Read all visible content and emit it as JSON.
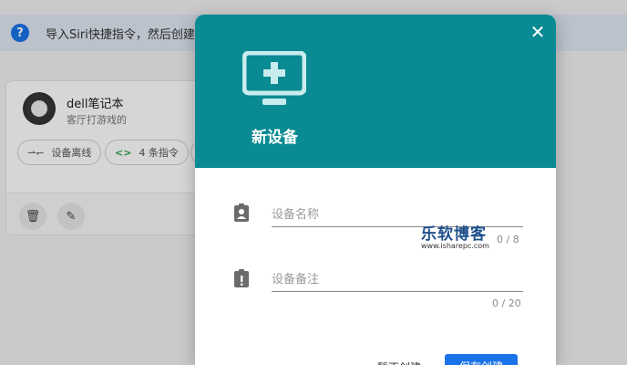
{
  "banner": {
    "icon": "question-circle-icon",
    "icon_glyph": "?",
    "text": "导入Siri快捷指令，然后创建"
  },
  "device_card": {
    "name": "dell笔记本",
    "note": "客厅打游戏的",
    "chips": [
      {
        "icon": "offline-arrows-icon",
        "glyph": "⇀↽",
        "label": "设备离线"
      },
      {
        "icon": "code-brackets-icon",
        "glyph": "<>",
        "label": "4 条指令"
      }
    ],
    "actions": [
      {
        "icon": "trash-icon",
        "glyph": "🗑"
      },
      {
        "icon": "pencil-icon",
        "glyph": "✎"
      }
    ]
  },
  "modal": {
    "header_color": "#0a8a92",
    "header_icon": "monitor-add-icon",
    "title": "新设备",
    "close_glyph": "✕",
    "fields": {
      "name": {
        "icon": "clipboard-account-icon",
        "placeholder": "设备名称",
        "value": "",
        "counter": "0 / 8"
      },
      "remark": {
        "icon": "clipboard-alert-icon",
        "placeholder": "设备备注",
        "value": "",
        "counter": "0 / 20"
      }
    },
    "cancel_label": "暂不创建",
    "create_label": "保存创建"
  },
  "watermark": {
    "main": "乐软博客",
    "url": "www.isharepc.com"
  },
  "colors": {
    "accent": "#1a73e8",
    "teal": "#0a8a92"
  }
}
